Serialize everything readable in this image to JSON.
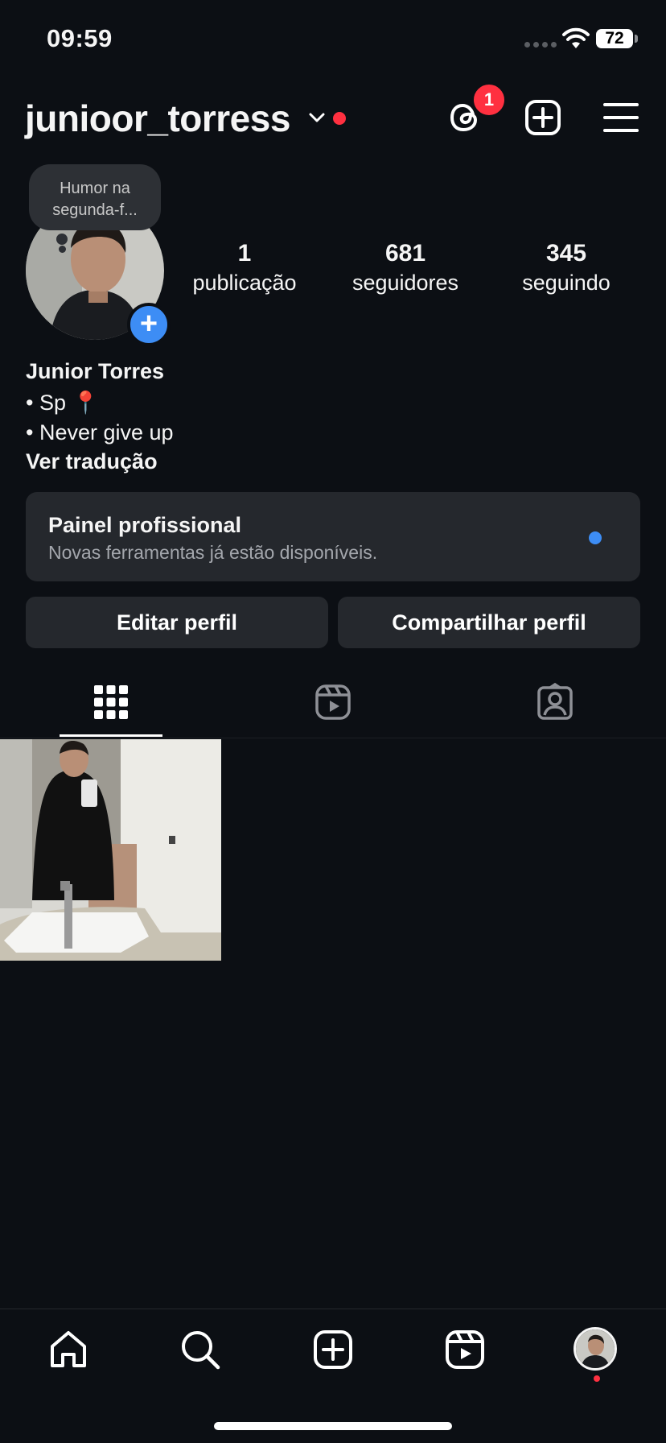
{
  "status_bar": {
    "time": "09:59",
    "battery": "72"
  },
  "header": {
    "username": "junioor_torress",
    "threads_badge": "1"
  },
  "profile": {
    "note_text": "Humor na segunda-f...",
    "stats": [
      {
        "num": "1",
        "label": "publicação"
      },
      {
        "num": "681",
        "label": "seguidores"
      },
      {
        "num": "345",
        "label": "seguindo"
      }
    ],
    "name": "Junior Torres",
    "bio_lines": [
      "• Sp 📍",
      "• Never give up"
    ],
    "translate": "Ver tradução"
  },
  "panel": {
    "title": "Painel profissional",
    "subtitle": "Novas ferramentas já estão disponíveis."
  },
  "buttons": {
    "edit": "Editar perfil",
    "share": "Compartilhar perfil"
  },
  "icons": {
    "header": [
      "threads-icon",
      "new-post-icon",
      "menu-icon"
    ],
    "tabs": [
      "grid-icon",
      "reels-icon",
      "tagged-icon"
    ],
    "nav": [
      "home-icon",
      "search-icon",
      "create-icon",
      "reels-icon",
      "profile-avatar"
    ]
  },
  "colors": {
    "background": "#0c0f14",
    "accent": "#3d8df5",
    "notification": "#ff3040",
    "surface": "#25282d"
  }
}
